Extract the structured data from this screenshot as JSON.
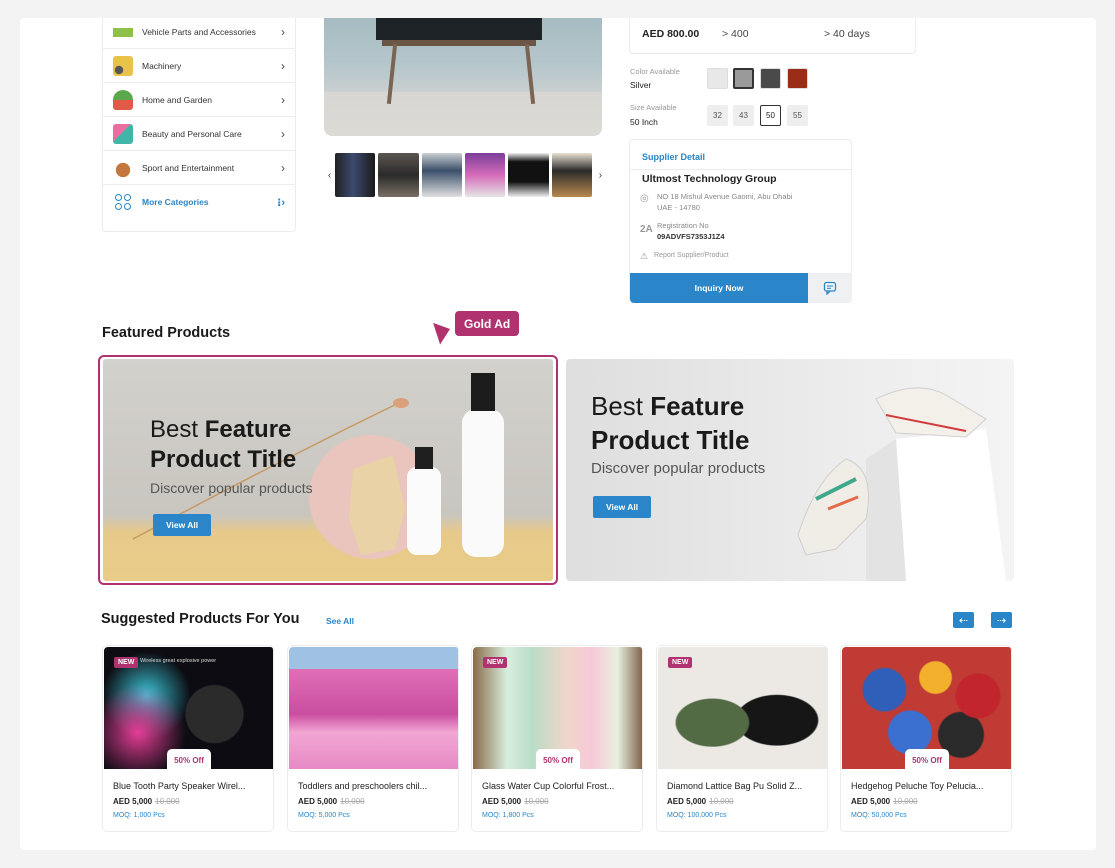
{
  "categories": [
    {
      "label": "Vehicle Parts and Accessories",
      "icon": "car-icon",
      "color": "#8fc14a"
    },
    {
      "label": "Machinery",
      "icon": "tractor-icon",
      "color": "#e8c34a"
    },
    {
      "label": "Home and Garden",
      "icon": "plant-icon",
      "color": "#e05a47"
    },
    {
      "label": "Beauty and Personal Care",
      "icon": "cosmetics-icon",
      "color": "#41b6a8"
    },
    {
      "label": "Sport and Entertainment",
      "icon": "sports-icon",
      "color": "#c5763f"
    }
  ],
  "more_categories": "More Categories",
  "product": {
    "price": "AED 800.00",
    "min_order": "> 400",
    "lead_time": "> 40 days",
    "color_label": "Color Available",
    "color_value": "Silver",
    "colors": [
      "#e8e8e8",
      "#9a9a9a",
      "#4a4a4a",
      "#9b2d17"
    ],
    "size_label": "Size Available",
    "size_value": "50 Inch",
    "sizes": [
      "32",
      "43",
      "50",
      "55"
    ]
  },
  "supplier": {
    "heading": "Supplier Detail",
    "name": "Ultmost Technology Group",
    "address_line1": "NO 18 Mishul Avenue Gaomi, Abu Dhabi",
    "address_line2": "UAE - 14780",
    "reg_label": "Registration No",
    "reg_value": "09ADVFS7353J1Z4",
    "report": "Report Supplier/Product",
    "inquiry_button": "Inquiry Now"
  },
  "featured": {
    "title": "Featured Products",
    "gold_tag": "Gold Ad",
    "banners": [
      {
        "line1_light": "Best ",
        "line1_bold": "Feature",
        "line2": "Product Title",
        "sub": "Discover popular products",
        "button": "View All"
      },
      {
        "line1_light": "Best ",
        "line1_bold": "Feature",
        "line2": "Product Title",
        "sub": "Discover popular products",
        "button": "View All"
      }
    ]
  },
  "suggested": {
    "title": "Suggested Products For You",
    "see_all": "See All",
    "items": [
      {
        "name": "Blue Tooth Party Speaker Wirel...",
        "price": "AED 5,000",
        "old": "10,000",
        "moq": "MOQ: 1,000 Pcs",
        "discount": "50% Off",
        "new": "NEW"
      },
      {
        "name": "Toddlers and preschoolers chil...",
        "price": "AED 5,000",
        "old": "10,000",
        "moq": "MOQ: 5,000 Pcs",
        "discount": "",
        "new": ""
      },
      {
        "name": "Glass Water Cup Colorful Frost...",
        "price": "AED 5,000",
        "old": "10,000",
        "moq": "MOQ: 1,800 Pcs",
        "discount": "50% Off",
        "new": "NEW"
      },
      {
        "name": "Diamond Lattice Bag Pu Solid Z...",
        "price": "AED 5,000",
        "old": "10,000",
        "moq": "MOQ: 100,000 Pcs",
        "discount": "",
        "new": "NEW"
      },
      {
        "name": "Hedgehog Peluche Toy Pelucia...",
        "price": "AED 5,000",
        "old": "10,000",
        "moq": "MOQ: 50,000 Pcs",
        "discount": "50% Off",
        "new": ""
      }
    ]
  },
  "speaker_promo_text": "Wireless great explosive power",
  "colors": {
    "accent": "#2a86c9",
    "brand": "#b0336f"
  }
}
